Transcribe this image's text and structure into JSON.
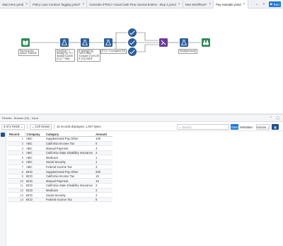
{
  "tabs": [
    {
      "label": "Start Here.yxmd",
      "active": false
    },
    {
      "label": "Policy Loan Contract Tagging.yxmd*",
      "active": false
    },
    {
      "label": "Generate IFRS17 Actual Cash Flow Journal Entries - Step 2.yxmd",
      "active": false
    },
    {
      "label": "New Workflow2*",
      "active": false
    },
    {
      "label": "Pay example.yxmd",
      "active": true
    }
  ],
  "run_label": "Run",
  "canvas": {
    "labels": {
      "input": "Pay Input.xlsx\nQuery=`Sheet1$`",
      "formula1": "[Tomt[T1]] + [\nIsNull([T1]) ? 0 +\nIsNull([T1]) AND\n[T1] != \"Total\"",
      "formula2": "IF IsNull([[T1]])\nTHEN Show\n!Compare [T2] ELSE\nIF [T1] ENDIF",
      "formula3": "[T1] != 0 compared [T2]",
      "formula4": "IsNull([Amount])"
    }
  },
  "results_title": "Results - Browse (16) - Input",
  "toolbar": {
    "fields_label": "3 of 3 Fields",
    "cell_viewer_label": "Cell Viewer",
    "records_info": "16 records displayed, 1,907 bytes",
    "search_placeholder": "Search",
    "data_label": "Data",
    "metadata_label": "Metadata",
    "actions_label": "Actions"
  },
  "table": {
    "headers": [
      "Record",
      "Company",
      "Category",
      "Amount"
    ],
    "rows": [
      [
        "1",
        "ABC",
        "Supplemental Pay Other",
        "100"
      ],
      [
        "2",
        "ABC",
        "California Income Tax",
        "6"
      ],
      [
        "3",
        "ABC",
        "Manual Payment",
        "4"
      ],
      [
        "4",
        "ABC",
        "California State Disability Insurance",
        "2"
      ],
      [
        "5",
        "ABC",
        "Medicare",
        "1"
      ],
      [
        "6",
        "ABC",
        "Social Security",
        "1"
      ],
      [
        "7",
        "ABC",
        "Federal Income Tax",
        "3"
      ],
      [
        "8",
        "BCD",
        "Supplemental Pay Other",
        "200"
      ],
      [
        "9",
        "BCD",
        "California Income Tax",
        "10"
      ],
      [
        "10",
        "BCD",
        "Manual Payment",
        "10"
      ],
      [
        "11",
        "BCD",
        "California State Disability Insurance",
        "2"
      ],
      [
        "12",
        "BCD",
        "Medicare",
        "2"
      ],
      [
        "13",
        "BCD",
        "Social Security",
        "2"
      ],
      [
        "14",
        "BCD",
        "Federal Income Tax",
        "6"
      ]
    ]
  },
  "colors": {
    "accent_blue": "#1e7ad6",
    "navy": "#1f4f8f",
    "input_green": "#2e8b57",
    "formula_blue": "#2a5d9a",
    "join_purple": "#6a3d9a",
    "browse_green": "#2e8b57"
  }
}
